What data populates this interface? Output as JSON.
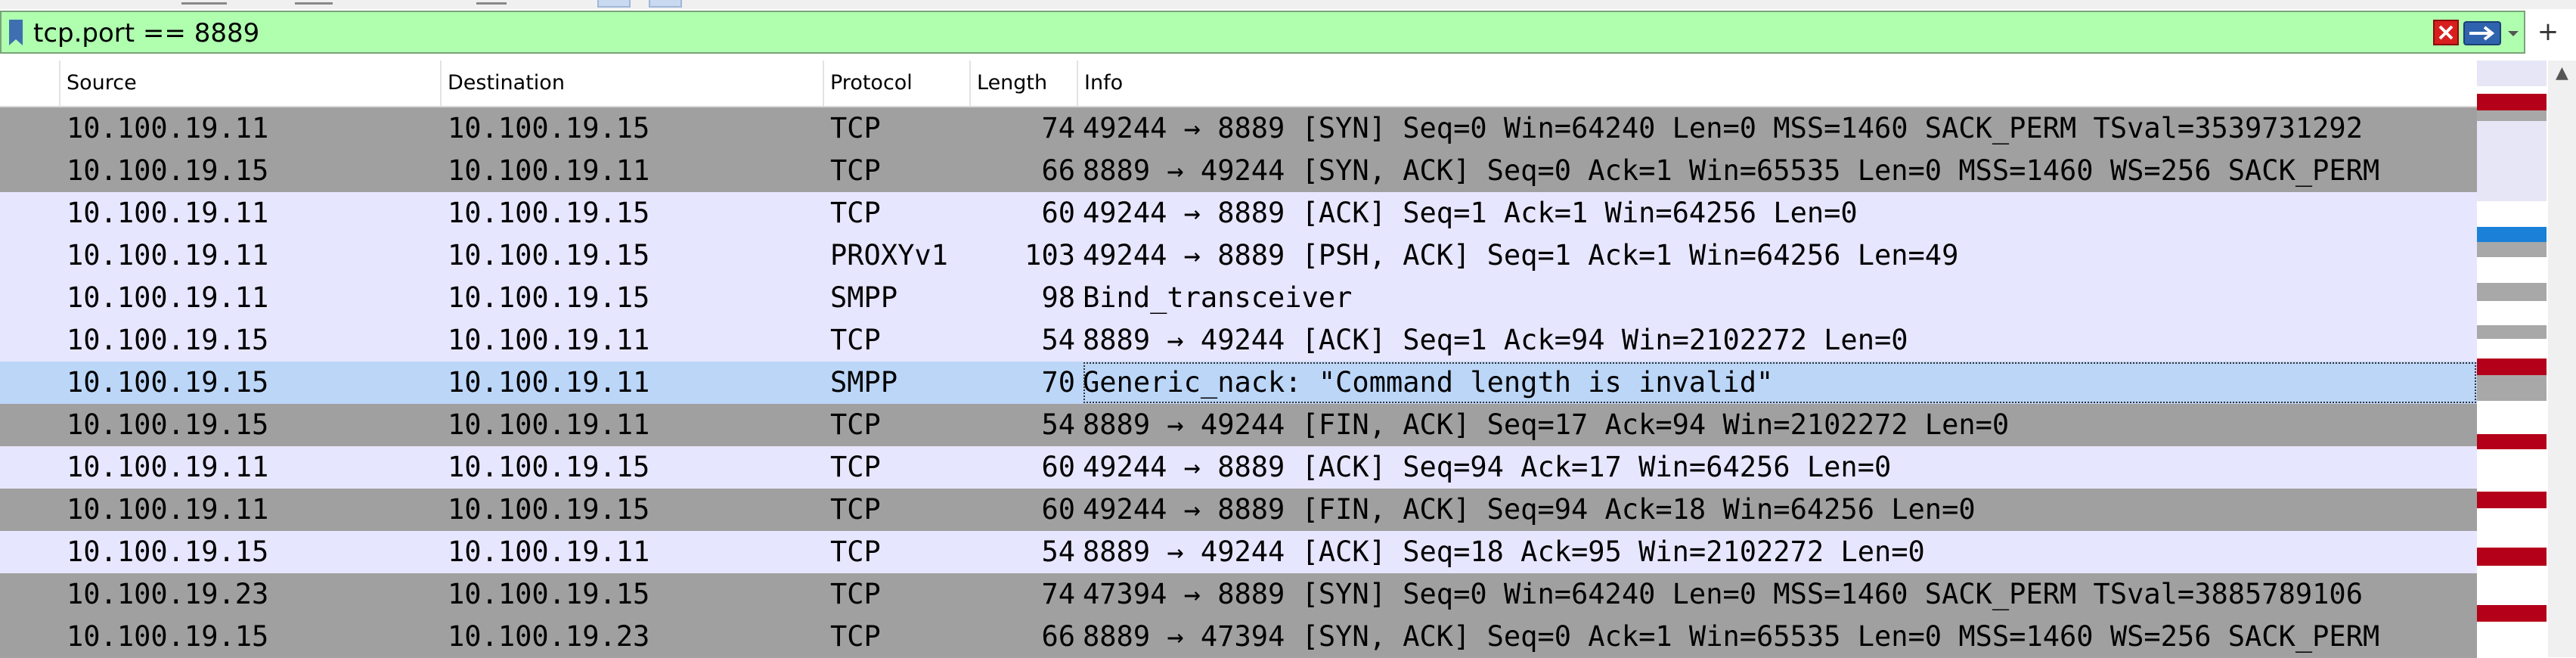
{
  "filter": {
    "value": "tcp.port == 8889",
    "bg_color": "#afffaf"
  },
  "toolbar": {
    "plus_label": "+"
  },
  "columns": {
    "source": "Source",
    "destination": "Destination",
    "protocol": "Protocol",
    "length": "Length",
    "info": "Info"
  },
  "colors": {
    "tcp_flag_row": "#a0a0a0",
    "tcp_row": "#e7e6ff",
    "selected_row": "#bcd6f8",
    "minimap_red": "#b5001a",
    "minimap_blue": "#1a80d8",
    "minimap_gray": "#a8a8a8",
    "minimap_light": "#e6e6f6"
  },
  "packets": [
    {
      "source": "10.100.19.11",
      "destination": "10.100.19.15",
      "protocol": "TCP",
      "length": "74",
      "info": "49244 → 8889 [SYN] Seq=0 Win=64240 Len=0 MSS=1460 SACK_PERM TSval=3539731292",
      "style": "dark"
    },
    {
      "source": "10.100.19.15",
      "destination": "10.100.19.11",
      "protocol": "TCP",
      "length": "66",
      "info": "8889 → 49244 [SYN, ACK] Seq=0 Ack=1 Win=65535 Len=0 MSS=1460 WS=256 SACK_PERM",
      "style": "dark"
    },
    {
      "source": "10.100.19.11",
      "destination": "10.100.19.15",
      "protocol": "TCP",
      "length": "60",
      "info": "49244 → 8889 [ACK] Seq=1 Ack=1 Win=64256 Len=0",
      "style": "light"
    },
    {
      "source": "10.100.19.11",
      "destination": "10.100.19.15",
      "protocol": "PROXYv1",
      "length": "103",
      "info": "49244 → 8889 [PSH, ACK] Seq=1 Ack=1 Win=64256 Len=49",
      "style": "light"
    },
    {
      "source": "10.100.19.11",
      "destination": "10.100.19.15",
      "protocol": "SMPP",
      "length": "98",
      "info": "Bind_transceiver",
      "style": "light"
    },
    {
      "source": "10.100.19.15",
      "destination": "10.100.19.11",
      "protocol": "TCP",
      "length": "54",
      "info": "8889 → 49244 [ACK] Seq=1 Ack=94 Win=2102272 Len=0",
      "style": "light"
    },
    {
      "source": "10.100.19.15",
      "destination": "10.100.19.11",
      "protocol": "SMPP",
      "length": "70",
      "info": "Generic_nack: \"Command length is invalid\"",
      "style": "selected"
    },
    {
      "source": "10.100.19.15",
      "destination": "10.100.19.11",
      "protocol": "TCP",
      "length": "54",
      "info": "8889 → 49244 [FIN, ACK] Seq=17 Ack=94 Win=2102272 Len=0",
      "style": "dark"
    },
    {
      "source": "10.100.19.11",
      "destination": "10.100.19.15",
      "protocol": "TCP",
      "length": "60",
      "info": "49244 → 8889 [ACK] Seq=94 Ack=17 Win=64256 Len=0",
      "style": "light"
    },
    {
      "source": "10.100.19.11",
      "destination": "10.100.19.15",
      "protocol": "TCP",
      "length": "60",
      "info": "49244 → 8889 [FIN, ACK] Seq=94 Ack=18 Win=64256 Len=0",
      "style": "dark"
    },
    {
      "source": "10.100.19.15",
      "destination": "10.100.19.11",
      "protocol": "TCP",
      "length": "54",
      "info": "8889 → 49244 [ACK] Seq=18 Ack=95 Win=2102272 Len=0",
      "style": "light"
    },
    {
      "source": "10.100.19.23",
      "destination": "10.100.19.15",
      "protocol": "TCP",
      "length": "74",
      "info": "47394 → 8889 [SYN] Seq=0 Win=64240 Len=0 MSS=1460 SACK_PERM TSval=3885789106",
      "style": "dark"
    },
    {
      "source": "10.100.19.15",
      "destination": "10.100.19.23",
      "protocol": "TCP",
      "length": "66",
      "info": "8889 → 47394 [SYN, ACK] Seq=0 Ack=1 Win=65535 Len=0 MSS=1460 WS=256 SACK_PERM",
      "style": "dark"
    }
  ]
}
